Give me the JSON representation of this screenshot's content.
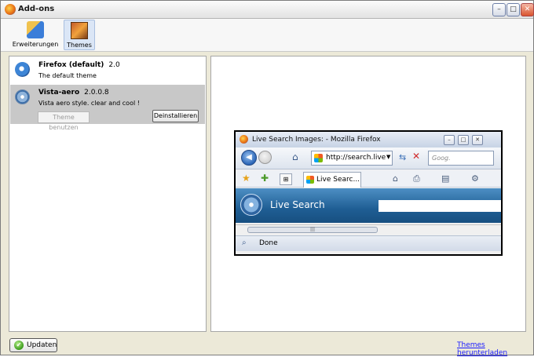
{
  "window": {
    "title": "Add-ons",
    "buttons": {
      "minimize": "–",
      "maximize": "□",
      "close": "✕"
    }
  },
  "toolbar": {
    "extensions_label": "Erweiterungen",
    "themes_label": "Themes"
  },
  "themes": [
    {
      "name": "Firefox (default)",
      "version": "2.0",
      "description": "The default theme",
      "icon": "firefox-theme-icon"
    },
    {
      "name": "Vista-aero",
      "version": "2.0.0.8",
      "description": "Vista aero style. clear and cool !",
      "icon": "vista-orb-icon",
      "use_label": "Theme benutzen",
      "uninstall_label": "Deinstallieren"
    }
  ],
  "preview": {
    "window_title": "Live Search Images: - Mozilla Firefox",
    "url": "http://search.live",
    "search_placeholder": "Goog.",
    "tab_label": "Live Searc...",
    "page_logo_text": "Live Search",
    "status_text": "Done"
  },
  "footer": {
    "update_label": "Updaten",
    "download_link": "Themes herunterladen"
  }
}
